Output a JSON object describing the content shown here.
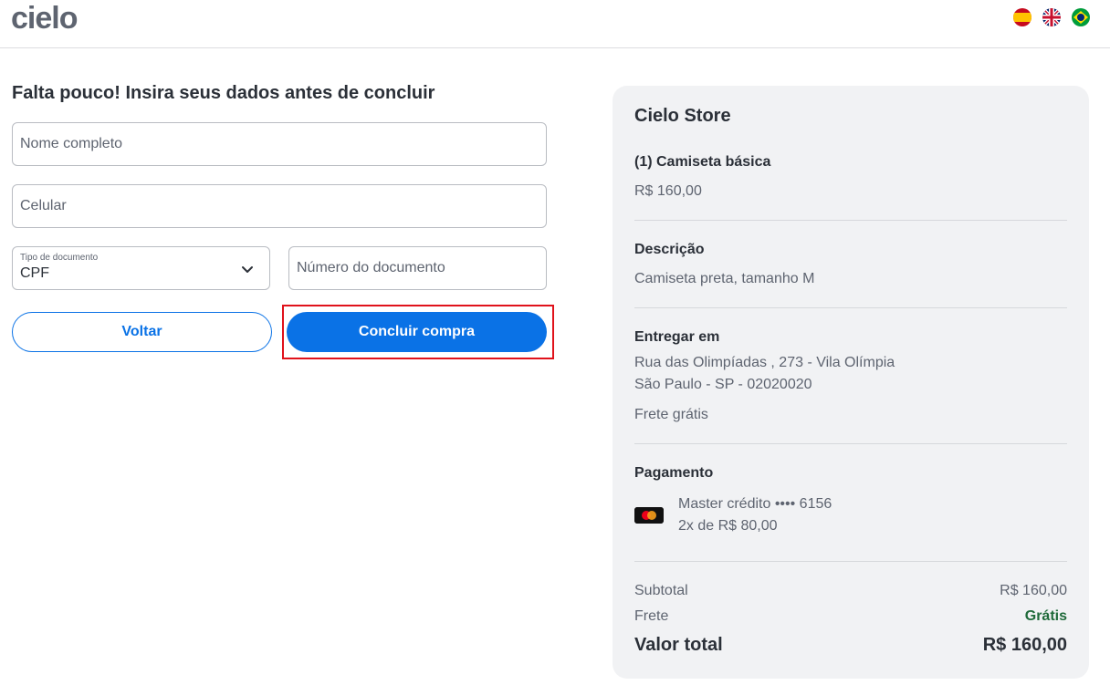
{
  "header": {
    "logo_text": "cielo",
    "flags": [
      "spain-flag-icon",
      "uk-flag-icon",
      "brazil-flag-icon"
    ]
  },
  "form": {
    "title": "Falta pouco! Insira seus dados antes de concluir",
    "name_placeholder": "Nome completo",
    "phone_placeholder": "Celular",
    "doc_type_label": "Tipo de documento",
    "doc_type_value": "CPF",
    "doc_number_placeholder": "Número do documento",
    "back_label": "Voltar",
    "submit_label": "Concluir compra"
  },
  "summary": {
    "store": "Cielo Store",
    "item_title": "(1) Camiseta básica",
    "item_price": "R$ 160,00",
    "description_label": "Descrição",
    "description_text": "Camiseta preta, tamanho M",
    "delivery_label": "Entregar em",
    "address_line1": "Rua das Olimpíadas , 273 - Vila Olímpia",
    "address_line2": "São Paulo - SP - 02020020",
    "shipping_note": "Frete grátis",
    "payment_label": "Pagamento",
    "card_line1": "Master crédito •••• 6156",
    "card_line2": "2x de R$ 80,00",
    "subtotal_label": "Subtotal",
    "subtotal_value": "R$ 160,00",
    "freight_label": "Frete",
    "freight_value": "Grátis",
    "total_label": "Valor total",
    "total_value": "R$ 160,00"
  },
  "colors": {
    "primary": "#0a72e6",
    "highlight": "#e0121b",
    "panel": "#f1f2f4",
    "success": "#1f6a3a"
  }
}
